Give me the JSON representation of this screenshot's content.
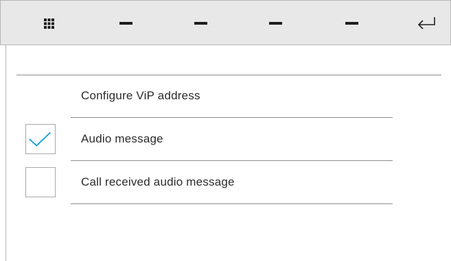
{
  "toolbar": {
    "buttons": [
      {
        "icon": "grid-icon"
      },
      {
        "icon": "dash-icon"
      },
      {
        "icon": "dash-icon"
      },
      {
        "icon": "dash-icon"
      },
      {
        "icon": "dash-icon"
      },
      {
        "icon": "back-arrow-icon"
      }
    ]
  },
  "menu": {
    "items": [
      {
        "label": "Configure ViP address",
        "has_checkbox": false
      },
      {
        "label": "Audio message",
        "has_checkbox": true,
        "checked": true
      },
      {
        "label": "Call received audio message",
        "has_checkbox": true,
        "checked": false
      }
    ]
  },
  "colors": {
    "toolbar_bg": "#e8e8e8",
    "icon": "#1e1e1e",
    "check_accent": "#1aa3d6",
    "divider": "#8c8c8c",
    "text": "#2b2b2b"
  }
}
